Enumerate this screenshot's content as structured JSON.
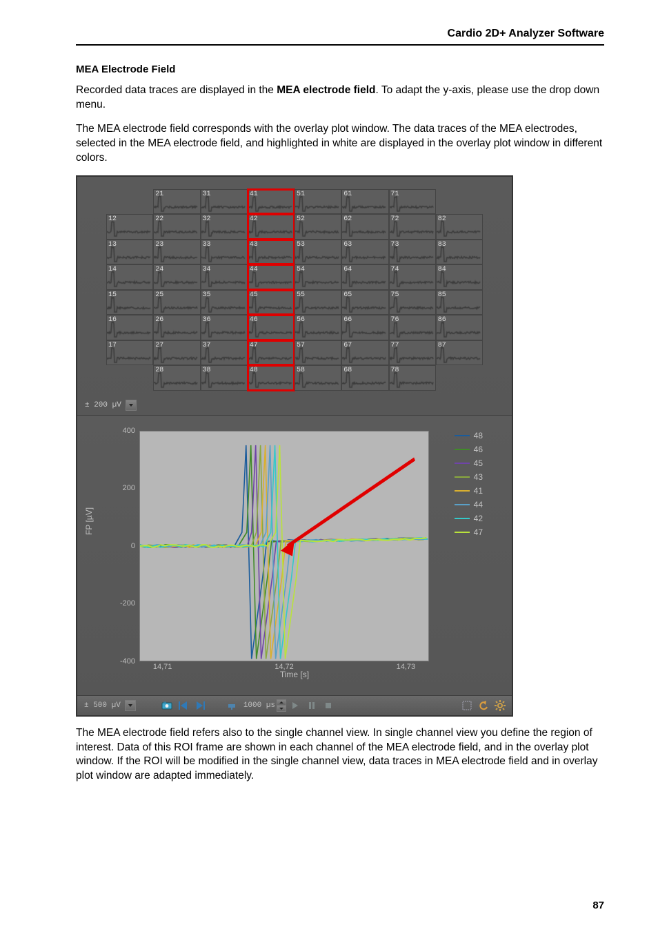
{
  "header": {
    "running_title": "Cardio 2D+ Analyzer Software"
  },
  "section": {
    "heading": "MEA Electrode Field"
  },
  "paragraphs": {
    "p1a": "Recorded data traces are displayed in the ",
    "p1b": "MEA electrode field",
    "p1c": ". To adapt the y-axis, please use the drop down menu.",
    "p2": "The MEA electrode field corresponds with the overlay plot window. The data traces of the MEA electrodes, selected in the MEA electrode field, and highlighted in white are displayed in the overlay plot window in different colors.",
    "p3": "The MEA electrode field refers also to the single channel view. In single channel view you define the region of interest. Data of this ROI frame are shown in each channel of the MEA electrode field, and in the overlay plot window. If the ROI will be modified in the single channel view, data traces in MEA electrode field and in overlay plot window are adapted immediately."
  },
  "mea_grid": {
    "y_axis_value": "± 200 µV",
    "layout": [
      [
        null,
        "21",
        "31",
        "41",
        "51",
        "61",
        "71",
        null
      ],
      [
        "12",
        "22",
        "32",
        "42",
        "52",
        "62",
        "72",
        "82"
      ],
      [
        "13",
        "23",
        "33",
        "43",
        "53",
        "63",
        "73",
        "83"
      ],
      [
        "14",
        "24",
        "34",
        "44",
        "54",
        "64",
        "74",
        "84"
      ],
      [
        "15",
        "25",
        "35",
        "45",
        "55",
        "65",
        "75",
        "85"
      ],
      [
        "16",
        "26",
        "36",
        "46",
        "56",
        "66",
        "76",
        "86"
      ],
      [
        "17",
        "27",
        "37",
        "47",
        "57",
        "67",
        "77",
        "87"
      ],
      [
        null,
        "28",
        "38",
        "48",
        "58",
        "68",
        "78",
        null
      ]
    ],
    "selected_column_label_prefix": "4"
  },
  "overlay_plot": {
    "y_label": "FP [µV]",
    "x_label": "Time [s]",
    "y_ticks": [
      400,
      200,
      0,
      -200,
      -400
    ],
    "x_ticks": [
      "14,71",
      "14,72",
      "14,73"
    ],
    "legend": [
      {
        "label": "48",
        "color": "#1a5c9c"
      },
      {
        "label": "46",
        "color": "#408b28"
      },
      {
        "label": "45",
        "color": "#6f44a8"
      },
      {
        "label": "43",
        "color": "#8aa93e"
      },
      {
        "label": "41",
        "color": "#d9b030"
      },
      {
        "label": "44",
        "color": "#5aa0c7"
      },
      {
        "label": "42",
        "color": "#34c9c9"
      },
      {
        "label": "47",
        "color": "#b9e23c"
      }
    ],
    "arrow_color": "#e00000"
  },
  "toolbar": {
    "y_axis_value": "± 500 µV",
    "time_window": "1000 µs"
  },
  "page_number": "87"
}
